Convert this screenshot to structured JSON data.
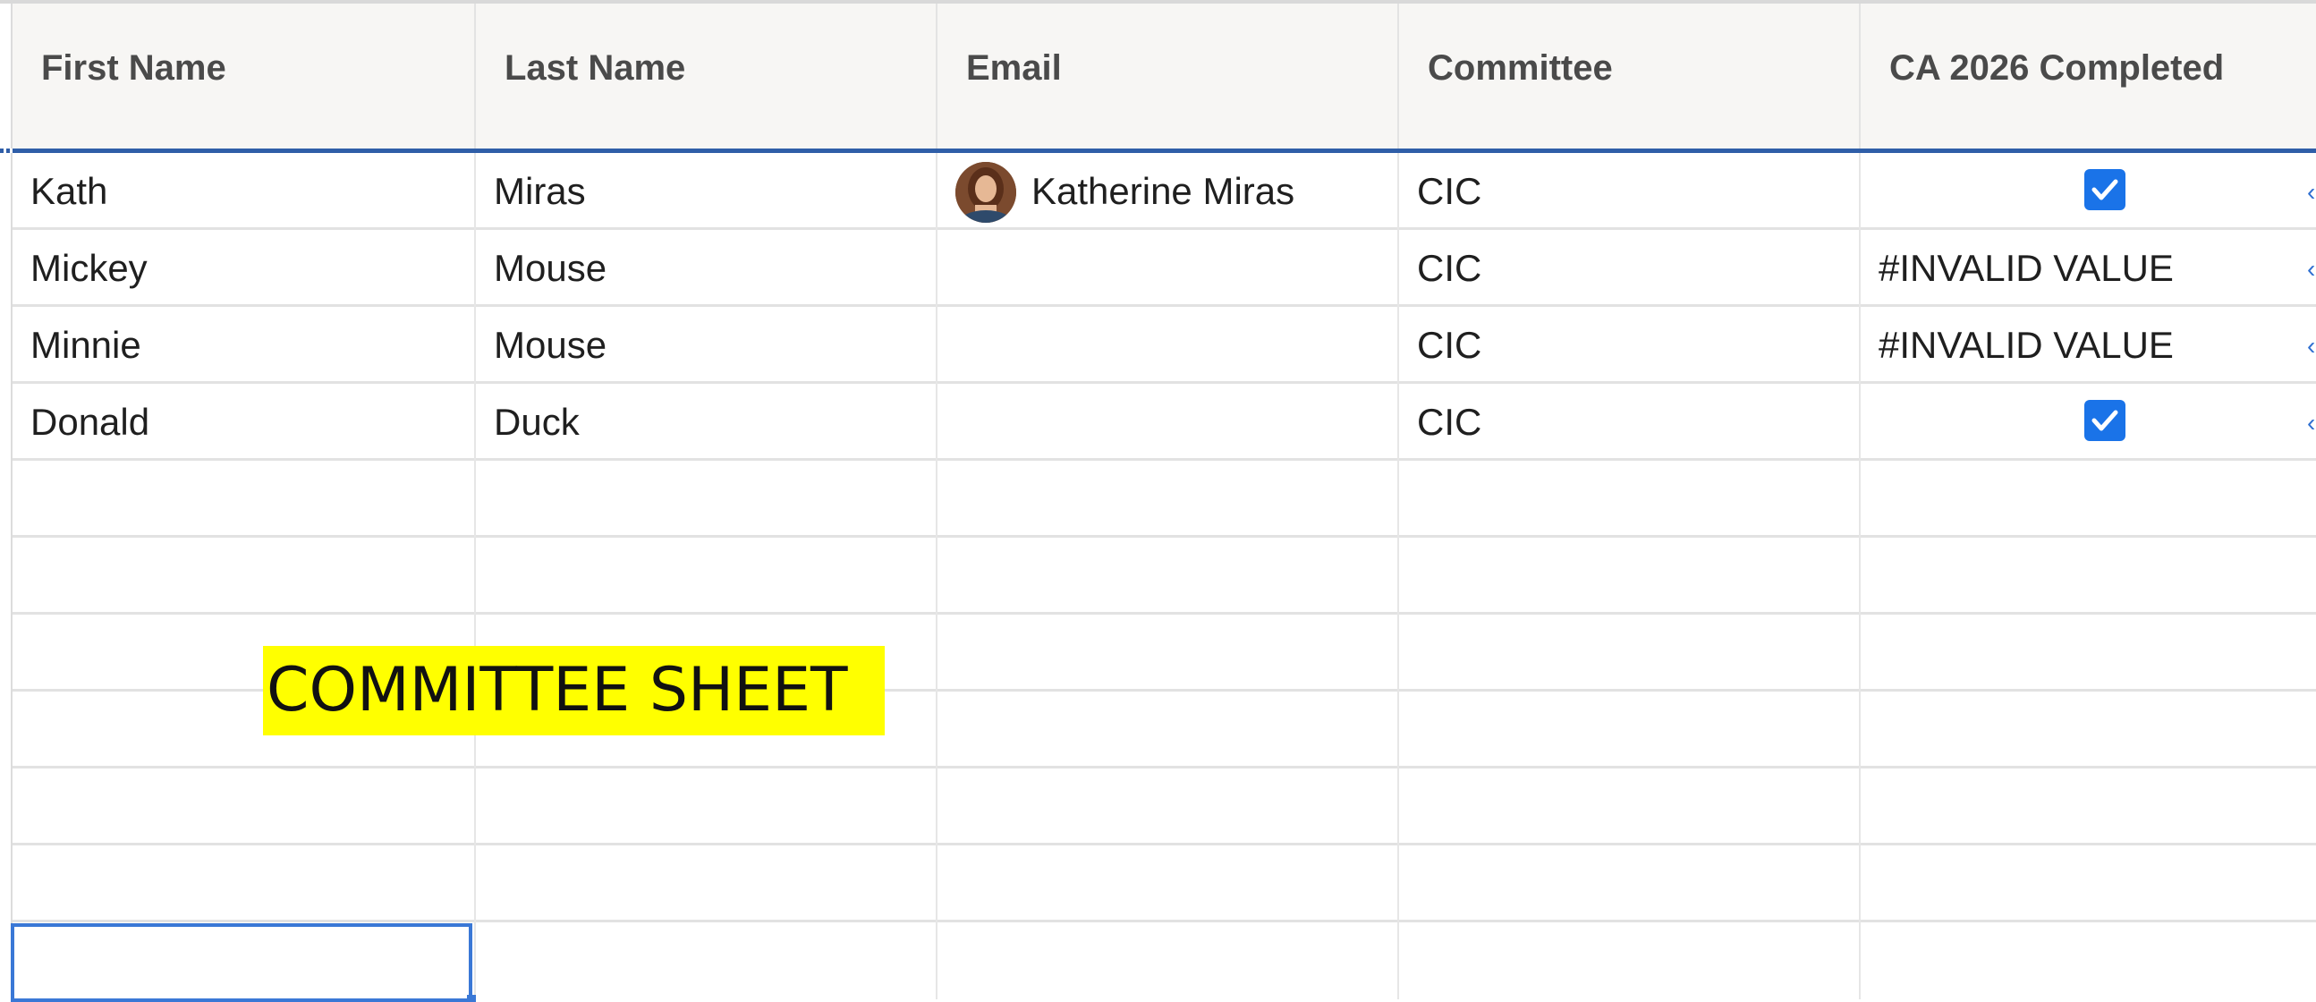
{
  "columns": [
    "First Name",
    "Last Name",
    "Email",
    "Committee",
    "CA 2026 Completed"
  ],
  "rows": [
    {
      "first_name": "Kath",
      "last_name": "Miras",
      "email": "Katherine Miras",
      "committee": "CIC",
      "ca_completed": "checked",
      "ca_text": ""
    },
    {
      "first_name": "Mickey",
      "last_name": "Mouse",
      "email": "",
      "committee": "CIC",
      "ca_completed": "text",
      "ca_text": "#INVALID VALUE"
    },
    {
      "first_name": "Minnie",
      "last_name": "Mouse",
      "email": "",
      "committee": "CIC",
      "ca_completed": "text",
      "ca_text": "#INVALID VALUE"
    },
    {
      "first_name": "Donald",
      "last_name": "Duck",
      "email": "",
      "committee": "CIC",
      "ca_completed": "checked",
      "ca_text": ""
    }
  ],
  "banner": {
    "text": "COMMITTEE SHEET",
    "background": "#ffff00"
  },
  "colors": {
    "accent": "#2f5ea8",
    "checkbox": "#1a73e8",
    "selection": "#3a78d6"
  },
  "icons": {
    "avatar": "user-avatar",
    "checkbox": "checkbox-checked-icon"
  }
}
